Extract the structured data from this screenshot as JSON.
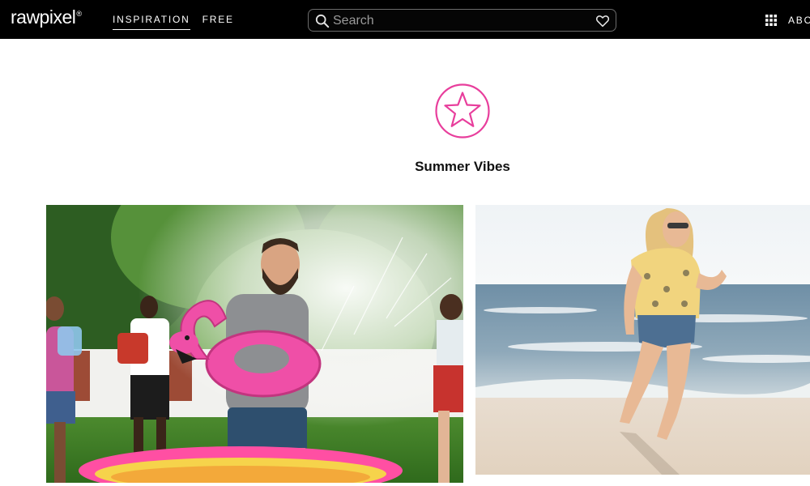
{
  "header": {
    "logo": "rawpixel",
    "logo_mark": "®",
    "nav": [
      {
        "label": "INSPIRATION",
        "active": true
      },
      {
        "label": "FREE",
        "active": false
      }
    ],
    "search": {
      "placeholder": "Search",
      "value": ""
    },
    "right_nav_label": "ABO"
  },
  "collection": {
    "icon": "star-icon",
    "title": "Summer Vibes",
    "accent_color": "#e83e9c"
  },
  "photos": [
    {
      "alt": "Friends having a water fight with a pink flamingo float in a garden"
    },
    {
      "alt": "Woman in floral shirt walking along the beach shoreline"
    }
  ]
}
